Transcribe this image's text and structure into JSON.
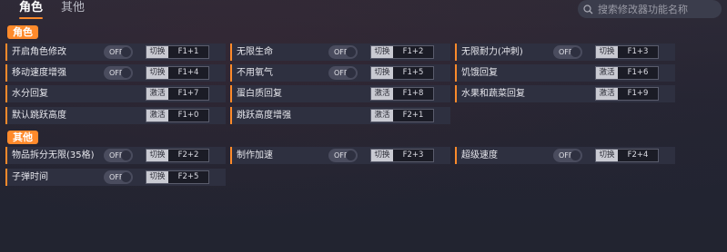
{
  "tabs": [
    {
      "label": "角色"
    },
    {
      "label": "其他"
    }
  ],
  "search": {
    "placeholder": "搜索修改器功能名称"
  },
  "sections": [
    {
      "title": "角色"
    },
    {
      "title": "其他"
    }
  ],
  "toggle_label": "OFF",
  "rows": [
    {
      "label": "开启角色修改",
      "toggle": "OFF",
      "action": "切换",
      "key": "F1+1"
    },
    {
      "label": "无限生命",
      "toggle": "OFF",
      "action": "切换",
      "key": "F1+2"
    },
    {
      "label": "无限耐力(冲刺)",
      "toggle": "OFF",
      "action": "切换",
      "key": "F1+3"
    },
    {
      "label": "移动速度增强",
      "toggle": "OFF",
      "action": "切换",
      "key": "F1+4"
    },
    {
      "label": "不用氧气",
      "toggle": "OFF",
      "action": "切换",
      "key": "F1+5"
    },
    {
      "label": "饥饿回复",
      "action": "激活",
      "key": "F1+6"
    },
    {
      "label": "水分回复",
      "action": "激活",
      "key": "F1+7"
    },
    {
      "label": "蛋白质回复",
      "action": "激活",
      "key": "F1+8"
    },
    {
      "label": "水果和蔬菜回复",
      "action": "激活",
      "key": "F1+9"
    },
    {
      "label": "默认跳跃高度",
      "action": "激活",
      "key": "F1+0"
    },
    {
      "label": "跳跃高度增强",
      "action": "激活",
      "key": "F2+1"
    },
    {
      "label": "物品拆分无限(35格)",
      "toggle": "OFF",
      "action": "切换",
      "key": "F2+2"
    },
    {
      "label": "制作加速",
      "toggle": "OFF",
      "action": "切换",
      "key": "F2+3"
    },
    {
      "label": "超级速度",
      "toggle": "OFF",
      "action": "切换",
      "key": "F2+4"
    },
    {
      "label": "子弹时间",
      "toggle": "OFF",
      "action": "切换",
      "key": "F2+5"
    }
  ],
  "colors": {
    "accent": "#ff8a2b",
    "background": "#232533",
    "row": "#2e3040"
  }
}
